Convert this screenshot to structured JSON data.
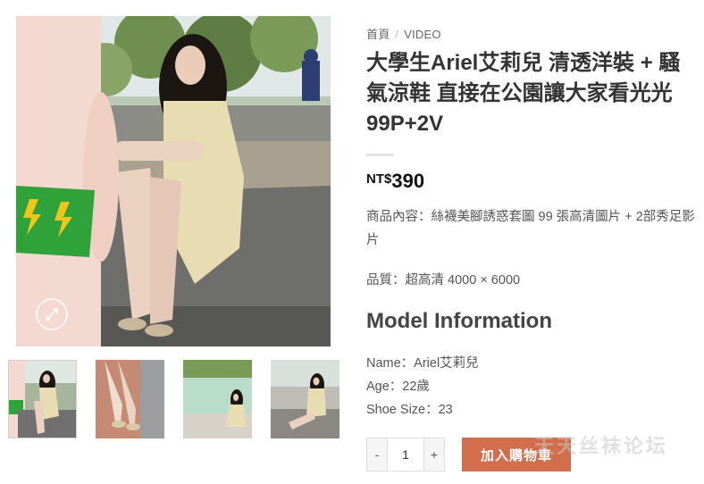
{
  "breadcrumb": {
    "home": "首頁",
    "separator": "/",
    "category": "VIDEO"
  },
  "product": {
    "title": "大學生Ariel艾莉兒 清透洋裝 + 騷氣涼鞋 直接在公園讓大家看光光 99P+2V",
    "price_currency": "NT$",
    "price_amount": "390",
    "description": "商品內容：絲襪美腳誘惑套圖 99 張高清圖片 + 2部秀足影片",
    "quality": "品質：超高清 4000 × 6000"
  },
  "model": {
    "heading": "Model Information",
    "name": "Name：Ariel艾莉兒",
    "age": "Age：22歲",
    "shoe_size": "Shoe Size：23"
  },
  "cart": {
    "minus_label": "-",
    "plus_label": "+",
    "quantity": "1",
    "add_label": "加入購物車"
  },
  "watermark": "天天丝袜论坛",
  "icons": {
    "zoom": "zoom-icon"
  },
  "colors": {
    "accent": "#d26e4b",
    "text": "#333333",
    "muted": "#555555"
  }
}
